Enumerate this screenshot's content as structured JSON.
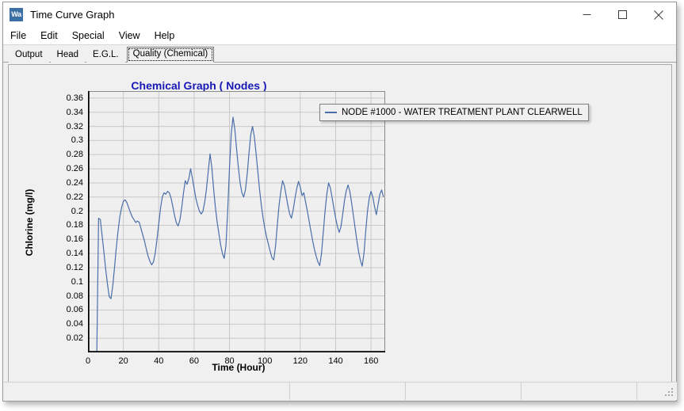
{
  "window": {
    "title": "Time Curve Graph",
    "icon_label": "Wa",
    "icon_name": "watercad-app-icon",
    "minimize_label": "Minimize",
    "maximize_label": "Maximize",
    "close_label": "Close"
  },
  "menu": {
    "items": [
      {
        "label": "File"
      },
      {
        "label": "Edit"
      },
      {
        "label": "Special"
      },
      {
        "label": "View"
      },
      {
        "label": "Help"
      }
    ]
  },
  "tabs": [
    {
      "label": "Output",
      "active": false
    },
    {
      "label": "Head",
      "active": false
    },
    {
      "label": "E.G.L.",
      "active": false
    },
    {
      "label": "Quality (Chemical)",
      "active": true
    }
  ],
  "colors": {
    "title_color": "#1818b8",
    "series_color": "#4a6ea9",
    "plot_background": "#efefef",
    "grid_color": "#c8c8c8",
    "axis_color": "#000000",
    "window_background": "#f0f0f0"
  },
  "status_bar": {
    "panels": [
      "",
      "",
      "",
      "",
      ""
    ]
  },
  "chart_data": {
    "type": "line",
    "title": "Chemical Graph ( Nodes )",
    "xlabel": "Time (Hour)",
    "ylabel": "Chlorine (mg/l)",
    "xlim": [
      0,
      168
    ],
    "ylim": [
      0,
      0.37
    ],
    "xticks": [
      0,
      20,
      40,
      60,
      80,
      100,
      120,
      140,
      160
    ],
    "yticks": [
      0.02,
      0.04,
      0.06,
      0.08,
      0.1,
      0.12,
      0.14,
      0.16,
      0.18,
      0.2,
      0.22,
      0.24,
      0.26,
      0.28,
      0.3,
      0.32,
      0.34,
      0.36
    ],
    "ytick_labels": [
      "0.02",
      "0.04",
      "0.06",
      "0.08",
      "0.1",
      "0.12",
      "0.14",
      "0.16",
      "0.18",
      "0.2",
      "0.22",
      "0.24",
      "0.26",
      "0.28",
      "0.3",
      "0.32",
      "0.34",
      "0.36"
    ],
    "minor_xticks_per_interval": 4,
    "minor_yticks_per_interval": 2,
    "grid": true,
    "legend_position": "right-outside",
    "series": [
      {
        "name": "NODE #1000 - WATER TREATMENT PLANT CLEARWELL",
        "color": "#4a6ea9",
        "x": [
          0,
          1,
          2,
          3,
          4,
          5,
          6,
          7,
          8,
          9,
          10,
          11,
          12,
          13,
          14,
          15,
          16,
          17,
          18,
          19,
          20,
          21,
          22,
          23,
          24,
          25,
          26,
          27,
          28,
          29,
          30,
          31,
          32,
          33,
          34,
          35,
          36,
          37,
          38,
          39,
          40,
          41,
          42,
          43,
          44,
          45,
          46,
          47,
          48,
          49,
          50,
          51,
          52,
          53,
          54,
          55,
          56,
          57,
          58,
          59,
          60,
          61,
          62,
          63,
          64,
          65,
          66,
          67,
          68,
          69,
          70,
          71,
          72,
          73,
          74,
          75,
          76,
          77,
          78,
          79,
          80,
          81,
          82,
          83,
          84,
          85,
          86,
          87,
          88,
          89,
          90,
          91,
          92,
          93,
          94,
          95,
          96,
          97,
          98,
          99,
          100,
          101,
          102,
          103,
          104,
          105,
          106,
          107,
          108,
          109,
          110,
          111,
          112,
          113,
          114,
          115,
          116,
          117,
          118,
          119,
          120,
          121,
          122,
          123,
          124,
          125,
          126,
          127,
          128,
          129,
          130,
          131,
          132,
          133,
          134,
          135,
          136,
          137,
          138,
          139,
          140,
          141,
          142,
          143,
          144,
          145,
          146,
          147,
          148,
          149,
          150,
          151,
          152,
          153,
          154,
          155,
          156,
          157,
          158,
          159,
          160,
          161,
          162,
          163,
          164,
          165,
          166,
          167
        ],
        "y": [
          0,
          0,
          0,
          0,
          0,
          0,
          0.19,
          0.188,
          0.165,
          0.142,
          0.118,
          0.097,
          0.079,
          0.076,
          0.094,
          0.12,
          0.148,
          0.172,
          0.192,
          0.205,
          0.214,
          0.216,
          0.212,
          0.205,
          0.198,
          0.192,
          0.188,
          0.184,
          0.186,
          0.184,
          0.175,
          0.166,
          0.157,
          0.146,
          0.136,
          0.129,
          0.124,
          0.128,
          0.14,
          0.16,
          0.182,
          0.204,
          0.22,
          0.226,
          0.224,
          0.228,
          0.226,
          0.218,
          0.206,
          0.193,
          0.183,
          0.179,
          0.188,
          0.205,
          0.226,
          0.243,
          0.238,
          0.246,
          0.26,
          0.247,
          0.232,
          0.218,
          0.208,
          0.2,
          0.196,
          0.2,
          0.213,
          0.232,
          0.257,
          0.281,
          0.262,
          0.232,
          0.206,
          0.185,
          0.168,
          0.152,
          0.14,
          0.133,
          0.152,
          0.202,
          0.262,
          0.31,
          0.333,
          0.316,
          0.288,
          0.262,
          0.24,
          0.226,
          0.22,
          0.23,
          0.252,
          0.282,
          0.308,
          0.32,
          0.306,
          0.282,
          0.256,
          0.23,
          0.208,
          0.19,
          0.175,
          0.163,
          0.153,
          0.143,
          0.134,
          0.131,
          0.15,
          0.18,
          0.208,
          0.228,
          0.243,
          0.236,
          0.222,
          0.208,
          0.196,
          0.19,
          0.202,
          0.218,
          0.232,
          0.242,
          0.234,
          0.222,
          0.226,
          0.213,
          0.2,
          0.186,
          0.172,
          0.158,
          0.146,
          0.136,
          0.128,
          0.123,
          0.14,
          0.17,
          0.2,
          0.224,
          0.24,
          0.233,
          0.219,
          0.204,
          0.19,
          0.178,
          0.17,
          0.178,
          0.196,
          0.215,
          0.229,
          0.237,
          0.228,
          0.212,
          0.194,
          0.176,
          0.158,
          0.142,
          0.13,
          0.122,
          0.14,
          0.172,
          0.2,
          0.219,
          0.228,
          0.22,
          0.206,
          0.195,
          0.21,
          0.224,
          0.23,
          0.22,
          0.198
        ]
      }
    ]
  }
}
